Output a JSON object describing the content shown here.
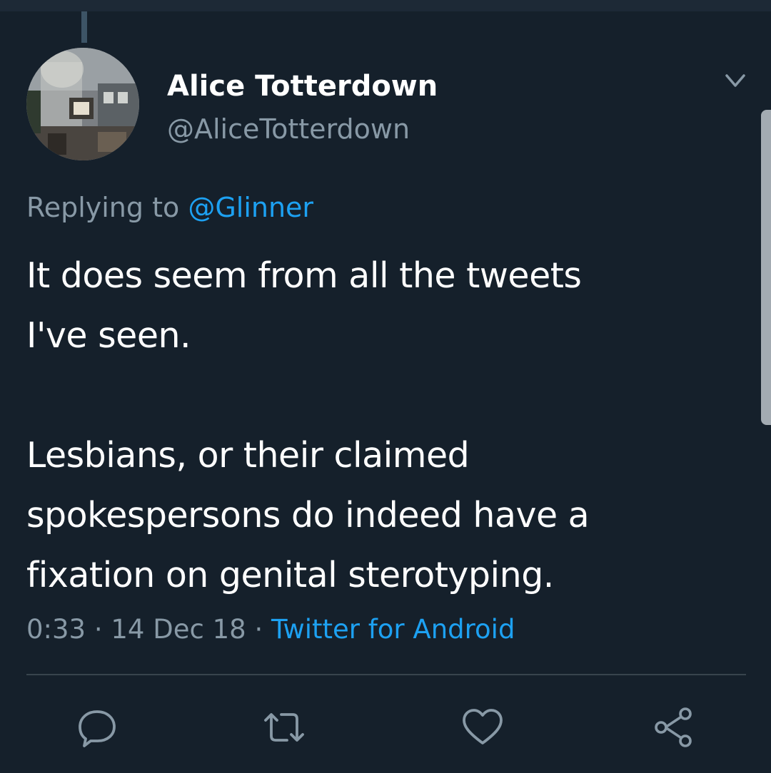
{
  "tweet": {
    "display_name": "Alice Totterdown",
    "handle": "@AliceTotterdown",
    "replying_prefix": "Replying to",
    "replying_to": "@Glinner",
    "text": "It does seem from all the tweets\nI've seen.\n\nLesbians, or their claimed\nspokespersons do indeed have a\nfixation on genital sterotyping.",
    "time": "0:33",
    "separator": " · ",
    "date": "14 Dec 18",
    "source": "Twitter for Android"
  },
  "icons": {
    "caret": "chevron-down-icon",
    "reply": "comment-icon",
    "retweet": "retweet-icon",
    "like": "heart-icon",
    "share": "share-icon"
  },
  "colors": {
    "background": "#15202b",
    "text_primary": "#ffffff",
    "text_secondary": "#8899a6",
    "accent": "#1da1f2",
    "divider": "#38444d"
  }
}
